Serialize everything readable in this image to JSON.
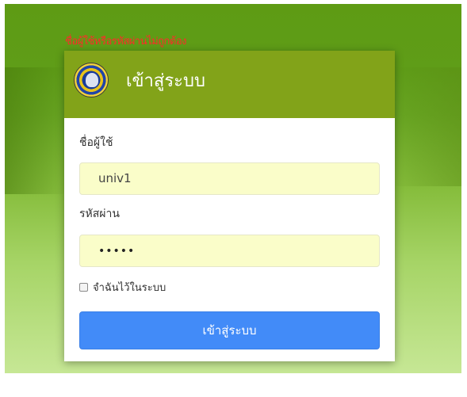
{
  "error": {
    "message": "ชื่อผู้ใช้หรือรหัสผ่านไม่ถูกต้อง"
  },
  "header": {
    "title": "เข้าสู่ระบบ"
  },
  "form": {
    "username_label": "ชื่อผู้ใช้",
    "username_value": "univ1",
    "password_label": "รหัสผ่าน",
    "password_value": "•••••",
    "remember_label": "จำฉันไว้ในระบบ",
    "remember_checked": false,
    "submit_label": "เข้าสู่ระบบ"
  },
  "colors": {
    "header_bg": "#82a319",
    "error": "#ff2a2a",
    "input_bg": "#fafdc9",
    "submit_bg": "#428bf8"
  }
}
